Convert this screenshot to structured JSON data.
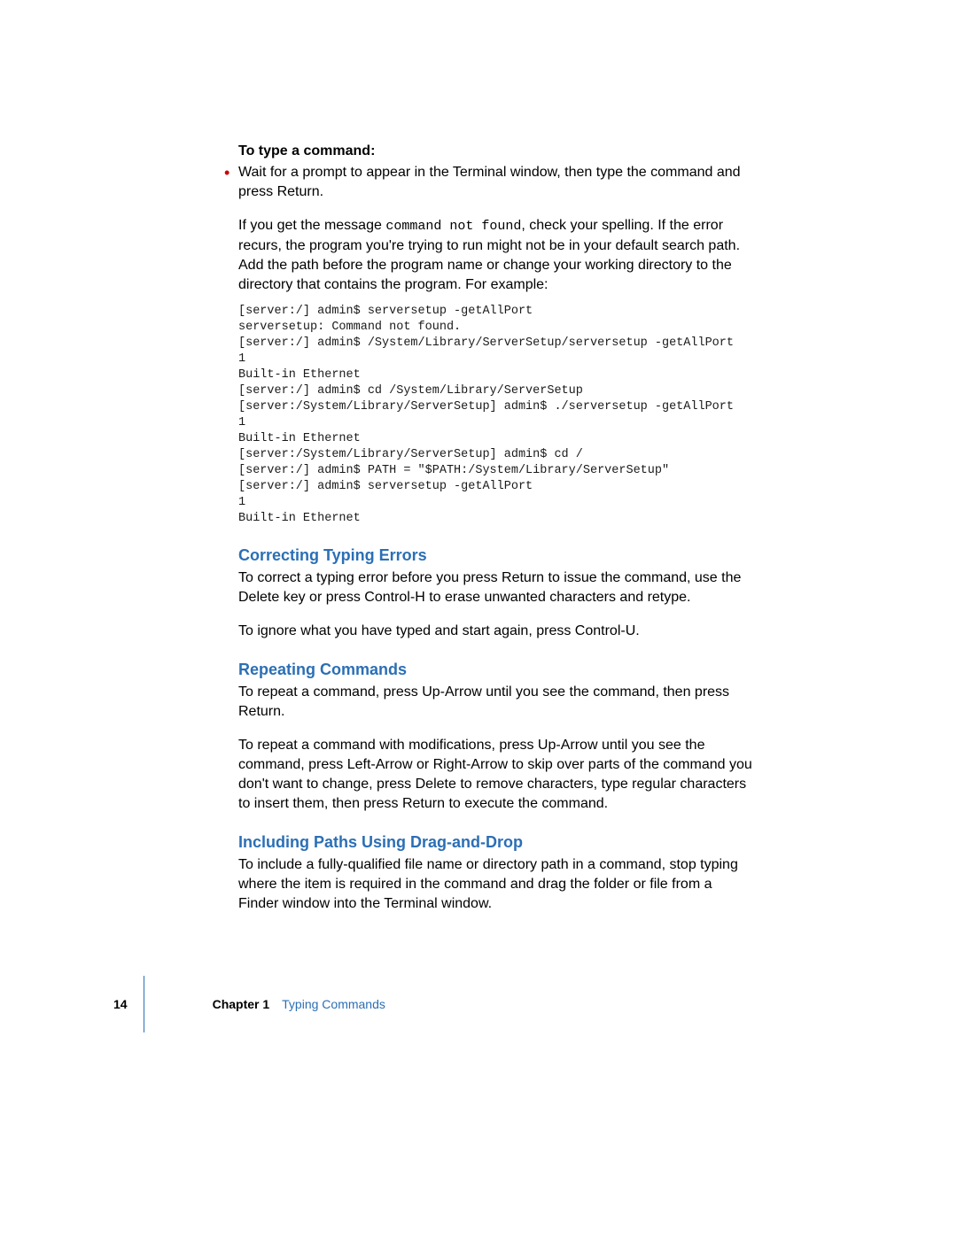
{
  "heading1": "To type a command:",
  "bullet1": "Wait for a prompt to appear in the Terminal window, then type the command and press Return.",
  "para1_a": "If you get the message ",
  "para1_code": "command not found",
  "para1_b": ", check your spelling. If the error recurs, the program you're trying to run might not be in your default search path. Add the path before the program name or change your working directory to the directory that contains the program. For example:",
  "code_block": "[server:/] admin$ serversetup -getAllPort\nserversetup: Command not found.\n[server:/] admin$ /System/Library/ServerSetup/serversetup -getAllPort\n1\nBuilt-in Ethernet\n[server:/] admin$ cd /System/Library/ServerSetup\n[server:/System/Library/ServerSetup] admin$ ./serversetup -getAllPort\n1\nBuilt-in Ethernet\n[server:/System/Library/ServerSetup] admin$ cd /\n[server:/] admin$ PATH = \"$PATH:/System/Library/ServerSetup\"\n[server:/] admin$ serversetup -getAllPort\n1\nBuilt-in Ethernet",
  "section1_heading": "Correcting Typing Errors",
  "section1_p1": "To correct a typing error before you press Return to issue the command, use the Delete key or press Control-H to erase unwanted characters and retype.",
  "section1_p2": "To ignore what you have typed and start again, press Control-U.",
  "section2_heading": "Repeating Commands",
  "section2_p1": "To repeat a command, press Up-Arrow until you see the command, then press Return.",
  "section2_p2": "To repeat a command with modifications, press Up-Arrow until you see the command, press Left-Arrow or Right-Arrow to skip over parts of the command you don't want to change, press Delete to remove characters, type regular characters to insert them, then press Return to execute the command.",
  "section3_heading": "Including Paths Using Drag-and-Drop",
  "section3_p1": "To include a fully-qualified file name or directory path in a command, stop typing where the item is required in the command and drag the folder or file from a Finder window into the Terminal window.",
  "footer": {
    "page_number": "14",
    "chapter_label": "Chapter 1",
    "chapter_title": "Typing Commands"
  }
}
